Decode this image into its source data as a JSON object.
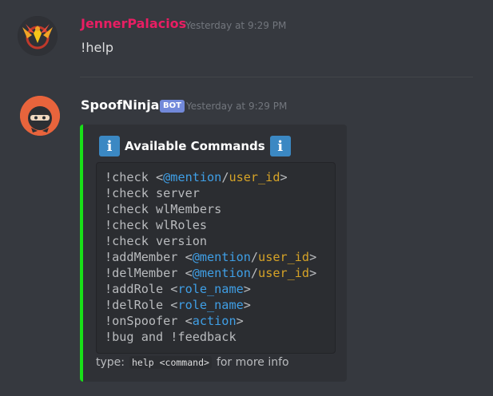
{
  "messages": [
    {
      "author": "JennerPalacios",
      "author_color": "#e91e63",
      "timestamp": "Yesterday at 9:29 PM",
      "content": "!help"
    },
    {
      "author": "SpoofNinja",
      "author_color": "#ffffff",
      "bot_tag": "BOT",
      "timestamp": "Yesterday at 9:29 PM",
      "embed": {
        "accent_color": "#18e018",
        "title": "Available Commands",
        "title_icon": "information-icon",
        "commands": [
          {
            "parts": [
              [
                "!check <",
                "plain"
              ],
              [
                "@mention",
                "blue"
              ],
              [
                "/",
                "plain"
              ],
              [
                "user_id",
                "gold"
              ],
              [
                ">",
                "plain"
              ]
            ]
          },
          {
            "parts": [
              [
                "!check server",
                "plain"
              ]
            ]
          },
          {
            "parts": [
              [
                "!check wlMembers",
                "plain"
              ]
            ]
          },
          {
            "parts": [
              [
                "!check wlRoles",
                "plain"
              ]
            ]
          },
          {
            "parts": [
              [
                "!check version",
                "plain"
              ]
            ]
          },
          {
            "parts": [
              [
                "!addMember <",
                "plain"
              ],
              [
                "@mention",
                "blue"
              ],
              [
                "/",
                "plain"
              ],
              [
                "user_id",
                "gold"
              ],
              [
                ">",
                "plain"
              ]
            ]
          },
          {
            "parts": [
              [
                "!delMember <",
                "plain"
              ],
              [
                "@mention",
                "blue"
              ],
              [
                "/",
                "plain"
              ],
              [
                "user_id",
                "gold"
              ],
              [
                ">",
                "plain"
              ]
            ]
          },
          {
            "parts": [
              [
                "!addRole <",
                "plain"
              ],
              [
                "role_name",
                "blue"
              ],
              [
                ">",
                "plain"
              ]
            ]
          },
          {
            "parts": [
              [
                "!delRole <",
                "plain"
              ],
              [
                "role_name",
                "blue"
              ],
              [
                ">",
                "plain"
              ]
            ]
          },
          {
            "parts": [
              [
                "!onSpoofer <",
                "plain"
              ],
              [
                "action",
                "blue"
              ],
              [
                ">",
                "plain"
              ]
            ]
          },
          {
            "parts": [
              [
                "!bug and !feedback",
                "plain"
              ]
            ]
          }
        ],
        "footer_prefix": "type:",
        "footer_code": "help <command>",
        "footer_suffix": "for more info"
      }
    }
  ]
}
